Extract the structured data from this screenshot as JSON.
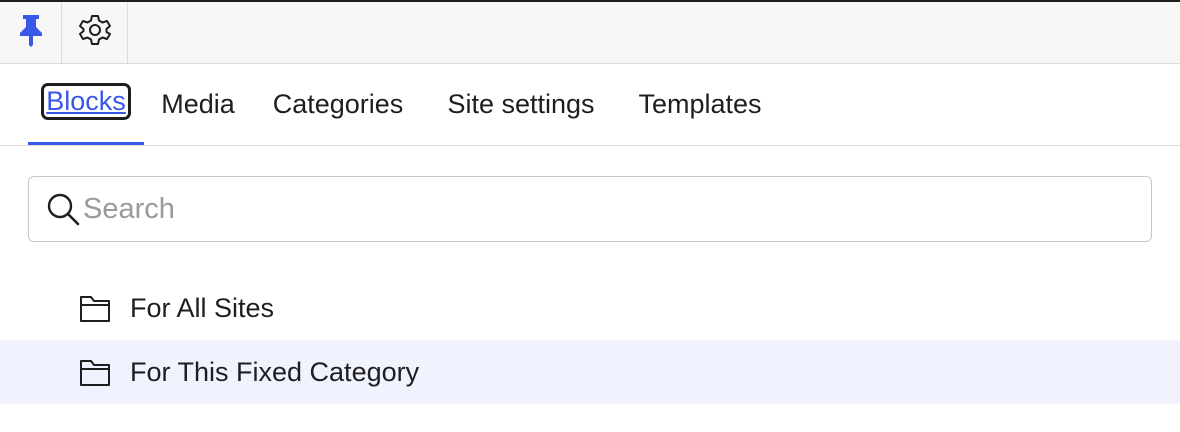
{
  "toolbar": {
    "pin_icon": "pin-icon",
    "settings_icon": "gear-icon"
  },
  "tabs": [
    {
      "id": "blocks",
      "label": "Blocks",
      "active": true
    },
    {
      "id": "media",
      "label": "Media",
      "active": false
    },
    {
      "id": "categories",
      "label": "Categories",
      "active": false
    },
    {
      "id": "site_settings",
      "label": "Site settings",
      "active": false
    },
    {
      "id": "templates",
      "label": "Templates",
      "active": false
    }
  ],
  "search": {
    "placeholder": "Search",
    "value": "",
    "icon": "search-icon"
  },
  "tree": {
    "items": [
      {
        "label": "For All Sites",
        "icon": "folder-icon",
        "selected": false
      },
      {
        "label": "For This Fixed Category",
        "icon": "folder-icon",
        "selected": true
      }
    ]
  },
  "colors": {
    "accent": "#3858e9",
    "selected_row": "#f0f2fd",
    "toolbar_bg": "#f7f7f7",
    "border": "#dcdcdc"
  }
}
